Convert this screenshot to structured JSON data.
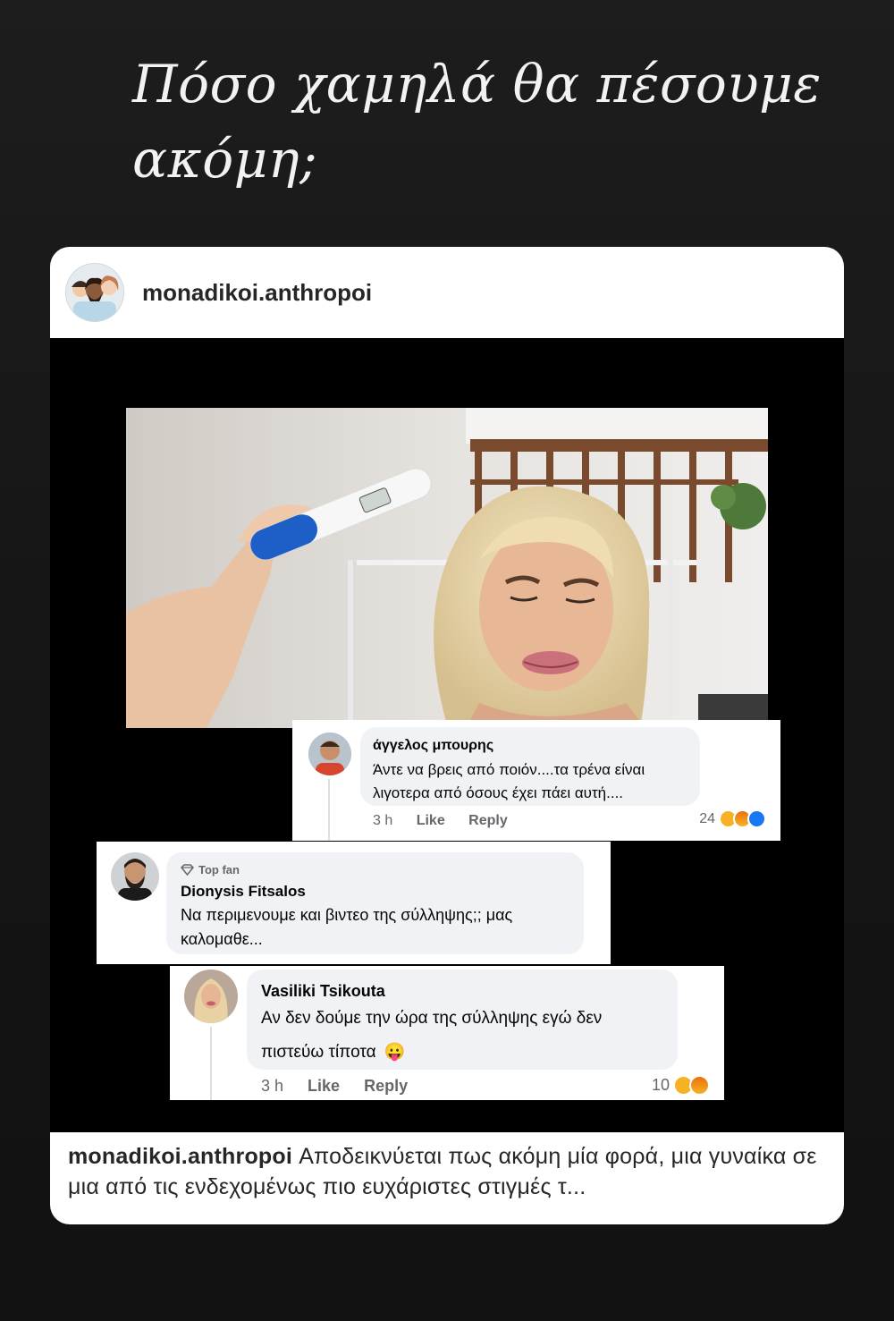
{
  "story": {
    "headline_line1": "Πόσο χαμηλά θα πέσουμε",
    "headline_line2": "ακόμη;"
  },
  "post": {
    "username": "monadikoi.anthropoi",
    "caption_user": "monadikoi.anthropoi",
    "caption_text": "Αποδεικνύεται πως ακόμη μία φορά, μια γυναίκα  σε μια από τις ενδεχομένως πιο ευχάριστες στιγμές τ..."
  },
  "comments": [
    {
      "name": "άγγελος μπουρης",
      "text_line1": "Άντε να βρεις από ποιόν....τα τρένα είναι",
      "text_line2": "λιγοτερα από όσους έχει πάει αυτή....",
      "time": "3 h",
      "like": "Like",
      "reply": "Reply",
      "reaction_count": "24",
      "reactions": [
        "haha-icon",
        "angry-icon",
        "like-icon"
      ]
    },
    {
      "badge": "Top fan",
      "name": "Dionysis Fitsalos",
      "text_line1": "Να περιμενουμε και βιντεο της σύλληψης;; μας",
      "text_line2": "καλομαθε..."
    },
    {
      "name": "Vasiliki Tsikouta",
      "text_line1": "Αν δεν δούμε την ώρα της σύλληψης εγώ δεν",
      "text_line2": "πιστεύω τίποτα",
      "emoji": "😛",
      "time": "3 h",
      "like": "Like",
      "reply": "Reply",
      "reaction_count": "10",
      "reactions": [
        "haha-icon",
        "angry-icon"
      ]
    }
  ]
}
